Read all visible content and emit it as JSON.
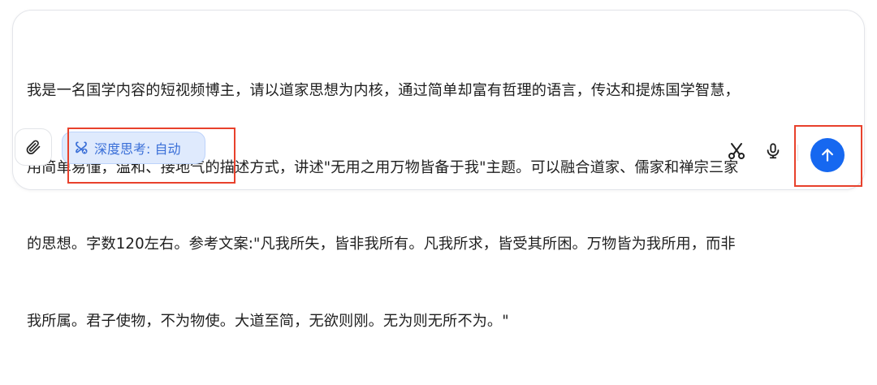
{
  "composer": {
    "prompt_lines": [
      "我是一名国学内容的短视频博主，请以道家思想为内核，通过简单却富有哲理的语言，传达和提炼国学智慧，",
      "用简单易懂，温和、接地气的描述方式，讲述\"无用之用万物皆备于我\"主题。可以融合道家、儒家和禅宗三家",
      "的思想。字数120左右。参考文案:\"凡我所失，皆非我所有。凡我所求，皆受其所困。万物皆为我所用，而非",
      "我所属。君子使物，不为物使。大道至简，无欲则刚。无为则无所不为。\""
    ],
    "attach_icon": "paperclip-icon",
    "deep_think": {
      "icon": "deep-think-icon",
      "label": "深度思考: 自动"
    },
    "tools": {
      "scissors_icon": "scissors-icon",
      "mic_icon": "microphone-icon",
      "send_icon": "arrow-up-icon"
    },
    "colors": {
      "accent": "#1668f0",
      "chip_bg": "#dfeafd",
      "chip_text": "#3a6fd8",
      "highlight": "#e8412c"
    }
  }
}
